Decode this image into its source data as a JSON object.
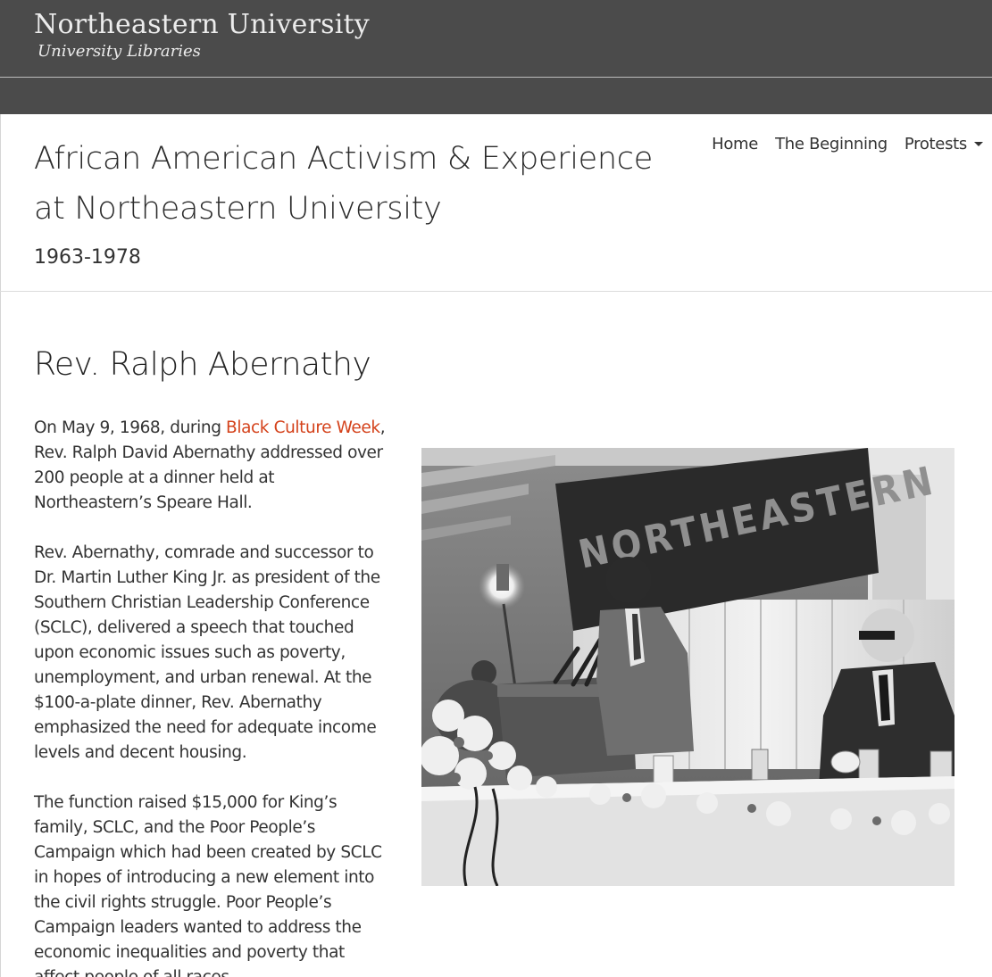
{
  "header": {
    "institution": "Northeastern University",
    "library": "University Libraries"
  },
  "site": {
    "title_line1": "African American Activism & Experience",
    "title_line2": "at Northeastern University",
    "years": "1963-1978"
  },
  "nav": {
    "items": [
      {
        "label": "Home"
      },
      {
        "label": "The Beginning"
      },
      {
        "label": "Protests"
      }
    ]
  },
  "article": {
    "title": "Rev. Ralph Abernathy",
    "p1_before_link": "On May 9, 1968, during ",
    "p1_link": "Black Culture Week",
    "p1_after_link": ", Rev. Ralph David Abernathy addressed over 200 people at a dinner held at Northeastern’s Speare Hall.",
    "p2": "Rev. Abernathy, comrade and successor to Dr. Martin Luther King Jr. as president of the Southern Christian Leadership Conference (SCLC), delivered a speech that touched upon economic issues such as poverty, unemployment, and urban renewal. At the $100-a-plate dinner, Rev. Abernathy emphasized the need for adequate income levels and decent housing.",
    "p3": "The function raised $15,000 for King’s family, SCLC, and the Poor People’s Campaign which had been created by SCLC in hopes of introducing a new element into the civil rights struggle. Poor People’s Campaign leaders wanted to address the economic inequalities and poverty that affect people of all races."
  },
  "photo": {
    "banner_text": "NORTHEASTERN"
  },
  "colors": {
    "topbar": "#4b4b4b",
    "link": "#d4421b"
  }
}
